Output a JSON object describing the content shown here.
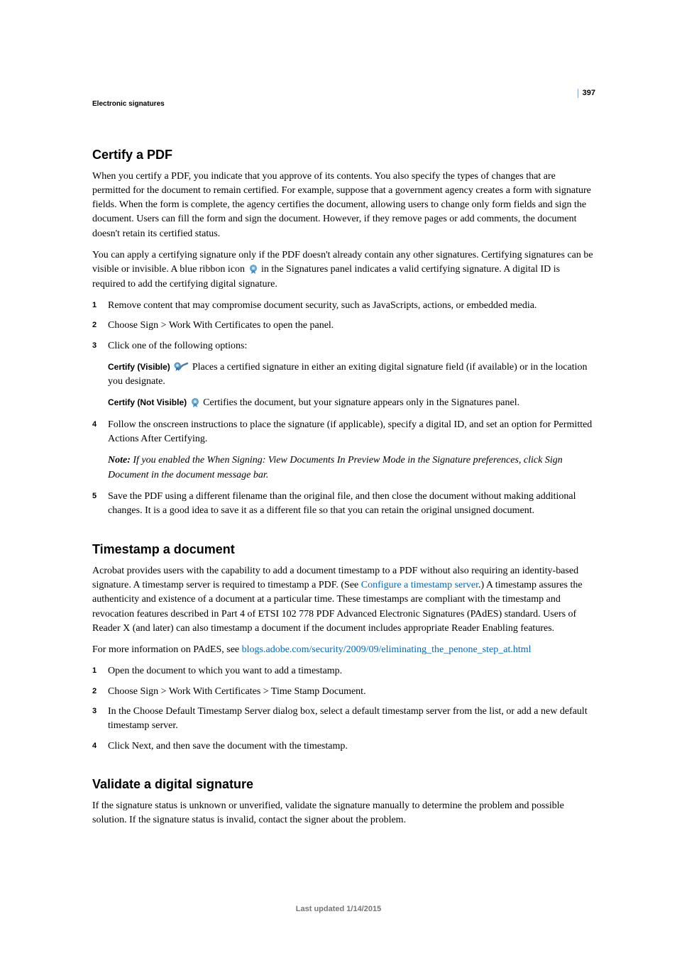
{
  "pageNumber": "397",
  "header": "Electronic signatures",
  "section1": {
    "title": "Certify a PDF",
    "p1": "When you certify a PDF, you indicate that you approve of its contents. You also specify the types of changes that are permitted for the document to remain certified. For example, suppose that a government agency creates a form with signature fields. When the form is complete, the agency certifies the document, allowing users to change only form fields and sign the document. Users can fill the form and sign the document. However, if they remove pages or add comments, the document doesn't retain its certified status.",
    "p2a": "You can apply a certifying signature only if the PDF doesn't already contain any other signatures. Certifying signatures can be visible or invisible. A blue ribbon icon ",
    "p2b": " in the Signatures panel indicates a valid certifying signature. A digital ID is required to add the certifying digital signature.",
    "steps": {
      "s1": "Remove content that may compromise document security, such as JavaScripts, actions, or embedded media.",
      "s2": "Choose Sign > Work With Certificates to open the panel.",
      "s3": "Click one of the following options:",
      "opt1Term": "Certify (Visible)",
      "opt1Text": "Places a certified signature in either an exiting digital signature field (if available) or in the location you designate.",
      "opt2Term": "Certify (Not Visible)",
      "opt2Text": "Certifies the document, but your signature appears only in the Signatures panel.",
      "s4": "Follow the onscreen instructions to place the signature (if applicable), specify a digital ID, and set an option for Permitted Actions After Certifying.",
      "noteLabel": "Note: ",
      "noteText": "If you enabled the When Signing: View Documents In Preview Mode in the Signature preferences, click Sign Document in the document message bar.",
      "s5": "Save the PDF using a different filename than the original file, and then close the document without making additional changes. It is a good idea to save it as a different file so that you can retain the original unsigned document."
    }
  },
  "section2": {
    "title": "Timestamp a document",
    "p1a": "Acrobat provides users with the capability to add a document timestamp to a PDF without also requiring an identity-based signature. A timestamp server is required to timestamp a PDF. (See ",
    "p1Link": "Configure a timestamp server",
    "p1b": ".) A timestamp assures the authenticity and existence of a document at a particular time. These timestamps are compliant with the timestamp and revocation features described in Part 4 of ETSI 102 778 PDF Advanced Electronic Signatures (PAdES) standard. Users of Reader X (and later) can also timestamp a document if the document includes appropriate Reader Enabling features.",
    "p2a": "For more information on PAdES, see ",
    "p2Link": "blogs.adobe.com/security/2009/09/eliminating_the_penone_step_at.html",
    "steps": {
      "s1": "Open the document to which you want to add a timestamp.",
      "s2": "Choose Sign > Work With Certificates > Time Stamp Document.",
      "s3": "In the Choose Default Timestamp Server dialog box, select a default timestamp server from the list, or add a new default timestamp server.",
      "s4": "Click Next, and then save the document with the timestamp."
    }
  },
  "section3": {
    "title": "Validate a digital signature",
    "p1": "If the signature status is unknown or unverified, validate the signature manually to determine the problem and possible solution. If the signature status is invalid, contact the signer about the problem."
  },
  "footer": "Last updated 1/14/2015"
}
